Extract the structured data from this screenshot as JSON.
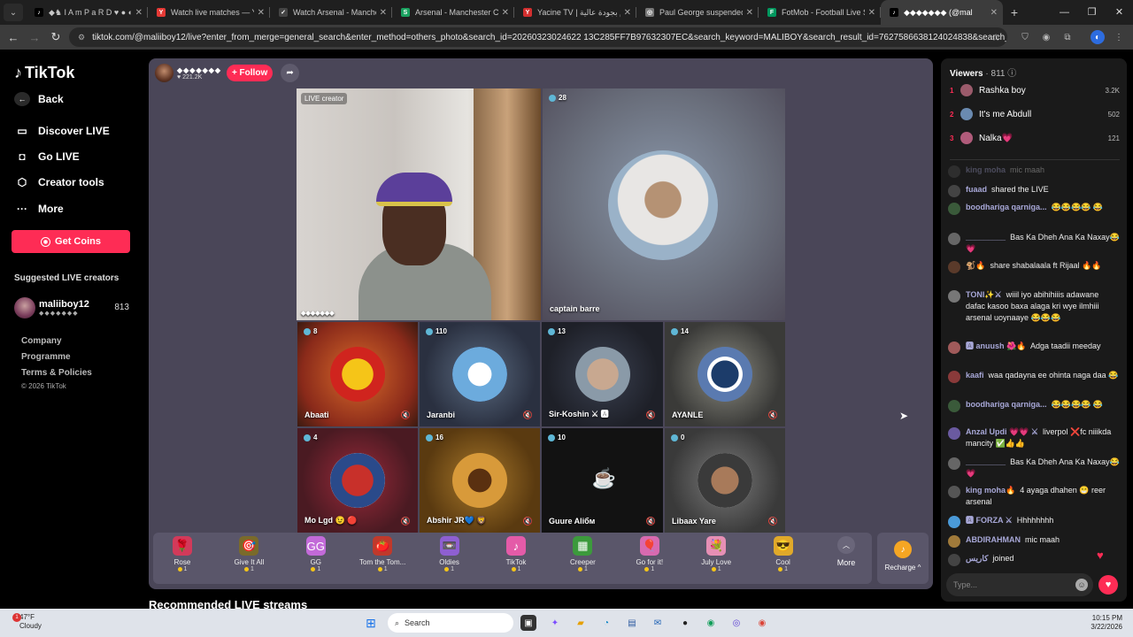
{
  "browser": {
    "tabs": [
      {
        "label": "◆♞ I A m P a R D ♥ ● ◐",
        "fav_color": "#000000",
        "fav_glyph": "♪",
        "active": false
      },
      {
        "label": "Watch live matches — Ya",
        "fav_color": "#e53935",
        "fav_glyph": "Y",
        "active": false
      },
      {
        "label": "Watch Arsenal - Manches",
        "fav_color": "#444444",
        "fav_glyph": "✓",
        "active": false
      },
      {
        "label": "Arsenal - Manchester City",
        "fav_color": "#1aa260",
        "fav_glyph": "S",
        "active": false
      },
      {
        "label": "Yacine TV | يوم بجودة عالية",
        "fav_color": "#d32f2f",
        "fav_glyph": "Y",
        "active": false
      },
      {
        "label": "Paul George suspended f",
        "fav_color": "#777777",
        "fav_glyph": "◎",
        "active": false
      },
      {
        "label": "FotMob - Football Live S",
        "fav_color": "#00985f",
        "fav_glyph": "F",
        "active": false
      },
      {
        "label": "◆◆◆◆◆◆◆ (@mal",
        "fav_color": "#000000",
        "fav_glyph": "♪",
        "active": true
      }
    ],
    "url": "tiktok.com/@maliiboy12/live?enter_from_merge=general_search&enter_method=others_photo&search_id=20260323024622 13C285FF7B97632307EC&search_keyword=MALIBOY&search_result_id=7627586638124024838&search_type=general"
  },
  "sidebar": {
    "brand": "TikTok",
    "nav": [
      {
        "label": "Back",
        "icon": "←"
      },
      {
        "label": "Discover LIVE",
        "icon": "▭"
      },
      {
        "label": "Go LIVE",
        "icon": "◘"
      },
      {
        "label": "Creator tools",
        "icon": "⬡"
      },
      {
        "label": "More",
        "icon": "···"
      }
    ],
    "coins_label": "Get Coins",
    "suggested_title": "Suggested LIVE creators",
    "creator": {
      "name": "maliiboy12",
      "sub": "◆◆◆◆◆◆◆",
      "count": "813"
    },
    "footer": [
      "Company",
      "Programme",
      "Terms & Policies"
    ],
    "copyright": "© 2026 TikTok"
  },
  "host": {
    "name": "◆◆◆◆◆◆◆",
    "likes": "221.2K",
    "follow_label": "+ Follow"
  },
  "cells": {
    "main": {
      "badge": "LIVE creator",
      "name": "◆◆◆◆◆◆◆"
    },
    "second": {
      "viewers": "28",
      "name": "captain barre"
    },
    "grid": [
      {
        "viewers": "8",
        "name": "Abaati"
      },
      {
        "viewers": "110",
        "name": "Jaranbi"
      },
      {
        "viewers": "13",
        "name": "Sir-Koshin ⚔ 🅰"
      },
      {
        "viewers": "14",
        "name": "AYANLE"
      },
      {
        "viewers": "4",
        "name": "Mo Lgd 😉 🔴"
      },
      {
        "viewers": "16",
        "name": "Abshir JR💙 🦁"
      },
      {
        "viewers": "10",
        "name": "Guure Aliбм"
      },
      {
        "viewers": "0",
        "name": "Libaax Yare"
      }
    ]
  },
  "gifts": [
    {
      "name": "Rose",
      "price": "1",
      "icon": "🌹",
      "bg": "#d23a5a"
    },
    {
      "name": "Give It All",
      "price": "1",
      "icon": "🎯",
      "bg": "#7a6a2a"
    },
    {
      "name": "GG",
      "price": "1",
      "icon": "GG",
      "bg": "#c26ad8"
    },
    {
      "name": "Tom the Tom...",
      "price": "1",
      "icon": "🍅",
      "bg": "#c0392b"
    },
    {
      "name": "Oldies",
      "price": "1",
      "icon": "📼",
      "bg": "#8e5fd1"
    },
    {
      "name": "TikTok",
      "price": "1",
      "icon": "♪",
      "bg": "#e45ba8"
    },
    {
      "name": "Creeper",
      "price": "1",
      "icon": "▦",
      "bg": "#3c9a3c"
    },
    {
      "name": "Go for it!",
      "price": "1",
      "icon": "🎈",
      "bg": "#d86ab0"
    },
    {
      "name": "July Love",
      "price": "1",
      "icon": "💐",
      "bg": "#e68fb5"
    },
    {
      "name": "Cool",
      "price": "1",
      "icon": "😎",
      "bg": "#e0a92a"
    }
  ],
  "more_label": "More",
  "recharge_label": "Recharge ^",
  "recommended_label": "Recommended LIVE streams",
  "chat": {
    "viewers_title": "Viewers",
    "viewers_count": "· 811",
    "ranks": [
      {
        "rank": "1",
        "name": "Rashka boy",
        "value": "3.2K",
        "color": "#9b5b6b"
      },
      {
        "rank": "2",
        "name": "It's me Abdull",
        "value": "502",
        "color": "#6a8ab0"
      },
      {
        "rank": "3",
        "name": "Nalka💗",
        "value": "121",
        "color": "#b05b7a"
      }
    ],
    "messages": [
      {
        "user": "king moha",
        "text": "mic maah",
        "color": "#555"
      },
      {
        "user": "fuaad",
        "text": "shared the LIVE",
        "color": "#444"
      },
      {
        "user": "boodhariga qarniga...",
        "text": "😂😂😂😂 😂",
        "color": "#3a5a3a"
      },
      {
        "user": "_________",
        "text": "Bas Ka Dheh Ana Ka Naxay😂💗",
        "color": "#666"
      },
      {
        "user": "🐒🔥",
        "text": "share shabalaala ft Rijaal 🔥🔥",
        "color": "#5a3a2a"
      },
      {
        "user": "TONI✨⚔",
        "text": "wiiil iyo abihihiiis adawane dafac kasoo baxa alaga kri wye ilmhiii arsenal uoynaaye 😂😂😂",
        "color": "#777"
      },
      {
        "user": "🅰 anuush 🌺🔥",
        "text": "Adga taadii meeday",
        "color": "#a05a5a"
      },
      {
        "user": "kaafi",
        "text": "waa qadayna ee ohinta naga daa 😂",
        "color": "#8a3a3a"
      },
      {
        "user": "boodhariga qarniga...",
        "text": "😂😂😂😂 😂",
        "color": "#3a5a3a"
      },
      {
        "user": "Anzal Updi 💗💗 ⚔",
        "text": "liverpol ❌fc niiikda mancity ✅👍👍",
        "color": "#6a5aa0"
      },
      {
        "user": "_________",
        "text": "Bas Ka Dheh Ana Ka Naxay😂💗",
        "color": "#666"
      },
      {
        "user": "king moha🔥",
        "text": "4 ayaga dhahen 😁 reer arsenal",
        "color": "#555"
      },
      {
        "user": "🅰 FORZA ⚔",
        "text": "Hhhhhhhh",
        "color": "#4a9ad8"
      },
      {
        "user": "ABDIRAHMAN",
        "text": "mic maah",
        "color": "#a07a3a"
      },
      {
        "user": "كاريس",
        "text": "joined",
        "color": "#444"
      }
    ],
    "type_placeholder": "Type..."
  },
  "taskbar": {
    "temp": "47°F",
    "weather": "Cloudy",
    "search": "Search",
    "time": "10:15 PM",
    "date": "3/22/2026"
  }
}
